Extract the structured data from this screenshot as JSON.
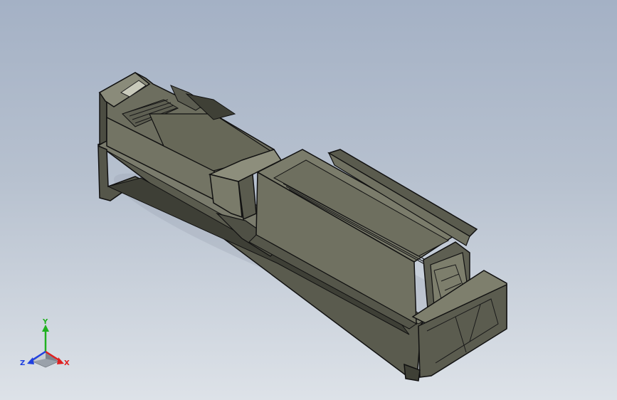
{
  "viewport": {
    "background_top": "#a4b1c5",
    "background_bottom": "#dde2e8",
    "model_color": "#6f7060"
  },
  "triad": {
    "x_label": "X",
    "y_label": "Y",
    "z_label": "Z",
    "x_color": "#e02020",
    "y_color": "#20b020",
    "z_color": "#2040e0"
  }
}
